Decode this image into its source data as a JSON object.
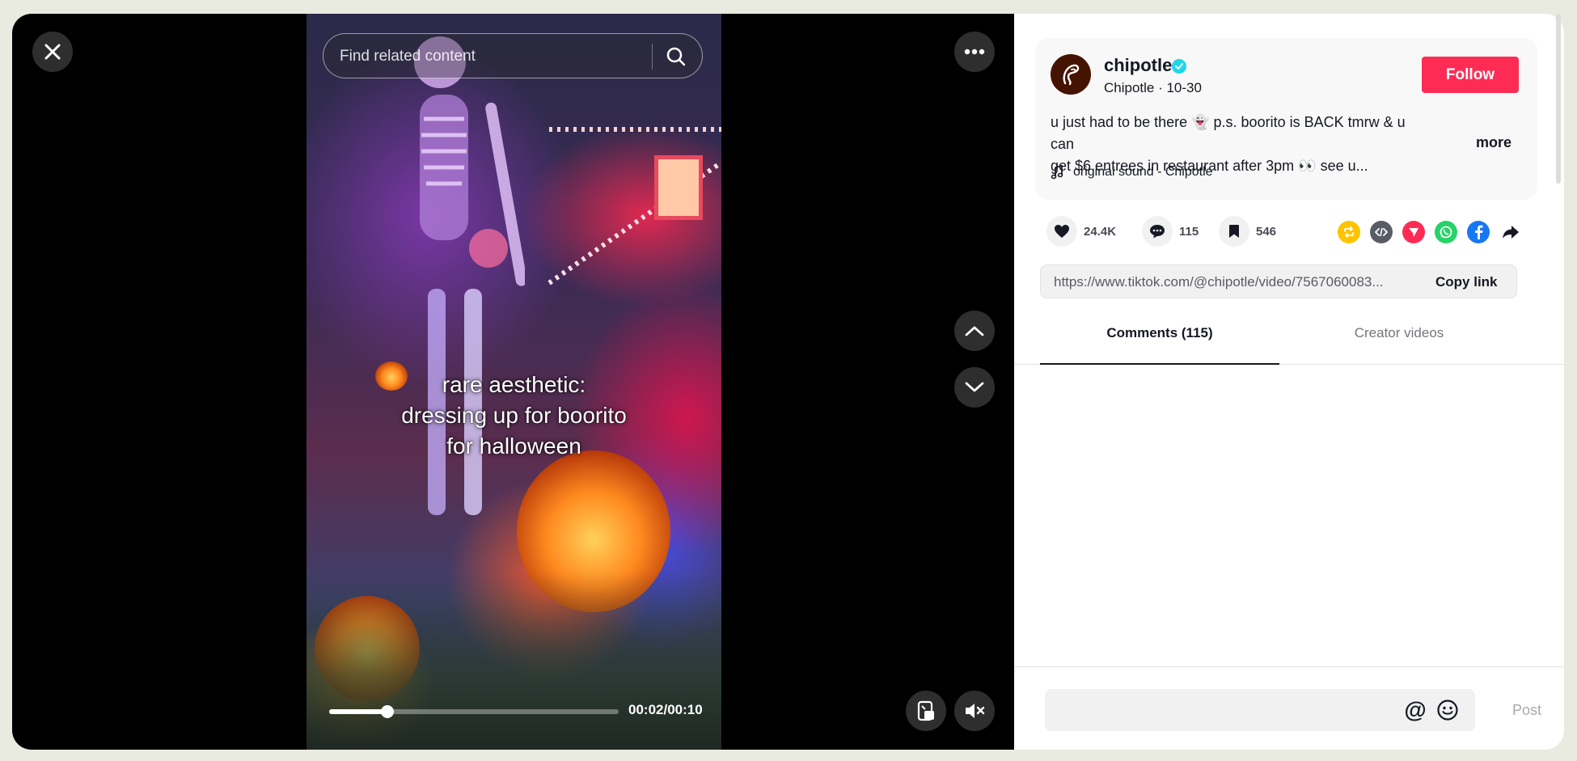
{
  "video": {
    "search_placeholder": "Find related content",
    "caption_lines": [
      "rare aesthetic:",
      "dressing up for boorito",
      "for halloween"
    ],
    "time_display": "00:02/00:10",
    "progress_fraction": 0.2
  },
  "post": {
    "username": "chipotle",
    "display_name": "Chipotle",
    "date": "10-30",
    "subline": "Chipotle · 10-30",
    "follow_label": "Follow",
    "description_line1": "u just had to be there 👻 p.s. boorito is BACK tmrw & u can",
    "description_line2": "get $6 entrees in restaurant after 3pm 👀 see u...",
    "more_label": "more",
    "sound": "original sound - Chipotle"
  },
  "stats": {
    "likes": "24.4K",
    "comments": "115",
    "saves": "546"
  },
  "share": {
    "url": "https://www.tiktok.com/@chipotle/video/7567060083...",
    "copy_label": "Copy link"
  },
  "tabs": [
    {
      "label": "Comments (115)",
      "active": true
    },
    {
      "label": "Creator videos",
      "active": false
    }
  ],
  "comment": {
    "placeholder": "",
    "post_label": "Post"
  },
  "icons": {
    "close": "close-icon",
    "more": "ellipsis-icon",
    "search": "search-icon",
    "up": "chevron-up-icon",
    "down": "chevron-down-icon",
    "mini_player": "mini-player-icon",
    "mute": "volume-muted-icon"
  },
  "colors": {
    "follow": "#fe2c55",
    "verified": "#20d5ec",
    "avatar_bg": "#451400",
    "repost": "#ffc300",
    "embed": "#5b5b66",
    "send": "#fe2c55",
    "whatsapp": "#25d366",
    "facebook": "#1877f2"
  }
}
